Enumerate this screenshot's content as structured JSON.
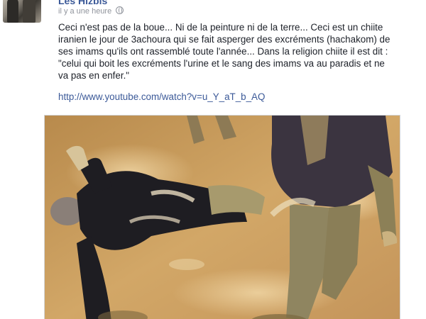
{
  "post": {
    "author": "Les Hizbis",
    "timestamp": "il y a une heure",
    "privacy_icon": "globe-icon",
    "text": "Ceci n'est pas de la boue... Ni de la peinture ni de la terre... Ceci est un chiite iranien  le jour de 3achoura qui se fait asperger des excréments (hachakom) de ses imams qu'ils ont rassemblé toute l'année... Dans la religion chiite il est dit : \"celui qui boit les excréments l'urine et le sang des imams va au paradis et ne va pas en enfer.\"",
    "link": "http://www.youtube.com/watch?v=u_Y_aT_b_AQ"
  },
  "colors": {
    "link": "#3b5998",
    "mud": "#c79a5a"
  }
}
